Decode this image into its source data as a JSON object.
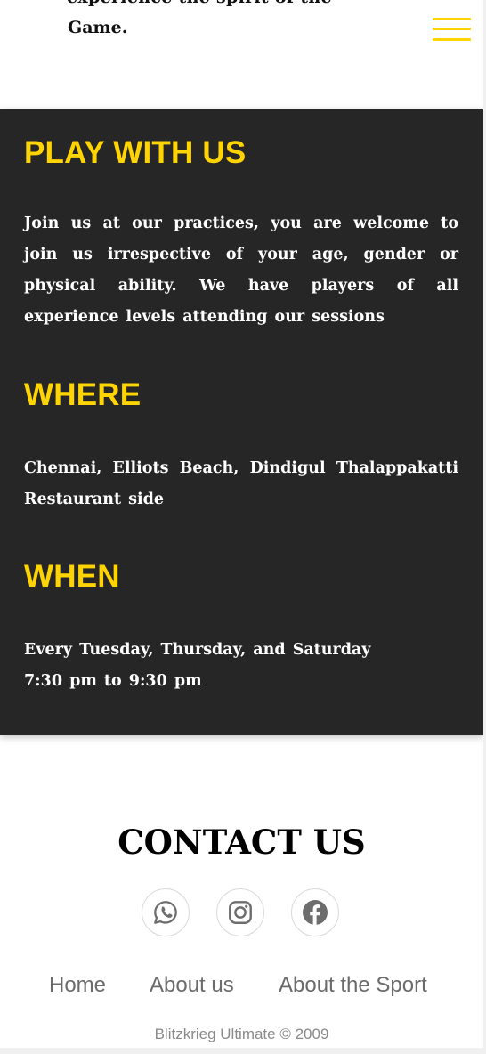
{
  "header": {
    "cut_text": "experience the spirit of the",
    "game_text": "Game.",
    "menu_icon": "hamburger-menu-icon",
    "accent_color": "#ffd400"
  },
  "play_section": {
    "play_title": "PLAY WITH US",
    "play_text": "Join us at our practices, you are welcome to join us irrespective of your age, gender or physical ability. We have players of all experience levels attending our sessions",
    "where_title": "WHERE",
    "where_text": "Chennai, Elliots Beach, Dindigul Thalappakatti Restaurant side",
    "when_title": "WHEN",
    "when_days": "Every Tuesday, Thursday, and Saturday",
    "when_time": "7:30 pm to 9:30 pm",
    "background_color": "#262626"
  },
  "contact": {
    "title": "CONTACT US",
    "social": [
      "whatsapp-icon",
      "instagram-icon",
      "facebook-icon"
    ]
  },
  "footer": {
    "nav": [
      "Home",
      "About us",
      "About the Sport"
    ],
    "copyright": "Blitzkrieg Ultimate © 2009"
  }
}
